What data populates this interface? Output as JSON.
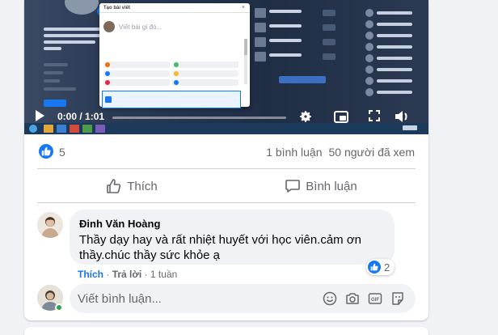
{
  "video": {
    "time": "0:00 / 1:01",
    "progress": 0,
    "dialog_title": "Tạo bài viết",
    "dialog_placeholder": "Viết bài gì đó..."
  },
  "stats": {
    "likes": "5",
    "comments": "1 bình luận",
    "views": "50 người đã xem"
  },
  "actions": {
    "like_label": "Thích",
    "comment_label": "Bình luận"
  },
  "comment": {
    "author": "Đinh Văn Hoàng",
    "text": "Thầy dạy hay và rất nhiệt huyết với học viên.cảm ơn thầy.chúc thầy sức khỏe ạ",
    "reaction_count": "2",
    "like_link": "Thích",
    "reply_link": "Trả lời",
    "separator": "·",
    "time": "1 tuần"
  },
  "composer": {
    "placeholder": "Viết bình luận..."
  },
  "colors": {
    "accent": "#1877f2",
    "online": "#31a24c"
  },
  "icons": [
    "like-icon",
    "play-icon",
    "settings-icon",
    "pip-icon",
    "fullscreen-icon",
    "volume-icon",
    "comment-icon",
    "emoji-icon",
    "camera-icon",
    "gif-icon",
    "sticker-icon"
  ]
}
